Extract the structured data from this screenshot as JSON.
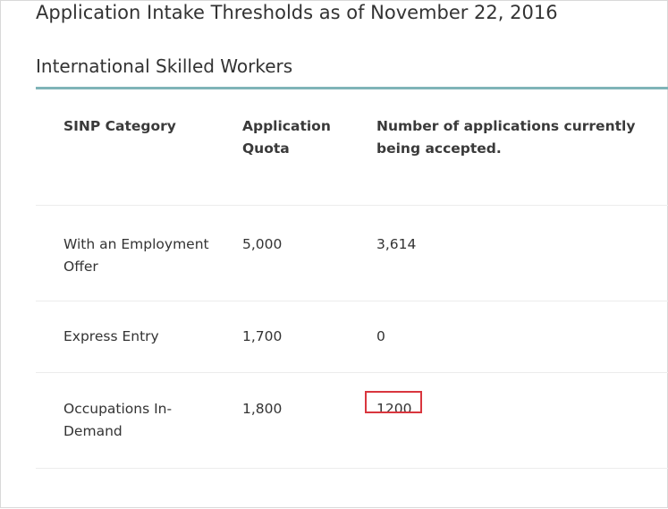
{
  "page": {
    "title": "Application Intake Thresholds as of November 22, 2016"
  },
  "section": {
    "title": "International Skilled Workers"
  },
  "table": {
    "columns": [
      "SINP Category",
      "Application Quota",
      "Number of applications currently being accepted."
    ],
    "rows": [
      {
        "category": "With an Employment Offer",
        "quota": "5,000",
        "accepted": "3,614"
      },
      {
        "category": "Express Entry",
        "quota": "1,700",
        "accepted": "0"
      },
      {
        "category": "Occupations In-Demand",
        "quota": "1,800",
        "accepted": "1200"
      }
    ]
  },
  "annotation": {
    "highlight_color": "#d9363e",
    "highlighted_cell": "Occupations In-Demand / accepted"
  }
}
